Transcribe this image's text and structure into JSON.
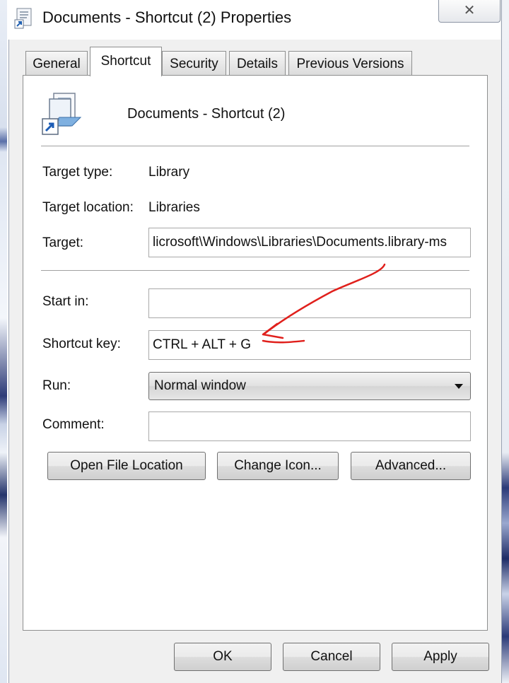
{
  "window": {
    "title": "Documents - Shortcut (2) Properties",
    "close_label": "✕"
  },
  "tabs": [
    {
      "label": "General",
      "active": false
    },
    {
      "label": "Shortcut",
      "active": true
    },
    {
      "label": "Security",
      "active": false
    },
    {
      "label": "Details",
      "active": false
    },
    {
      "label": "Previous Versions",
      "active": false
    }
  ],
  "shortcut": {
    "name": "Documents - Shortcut (2)",
    "icon": "library-shortcut-icon"
  },
  "fields": {
    "target_type": {
      "label": "Target type:",
      "value": "Library"
    },
    "target_location": {
      "label": "Target location:",
      "value": "Libraries"
    },
    "target": {
      "label": "Target:",
      "value": "licrosoft\\Windows\\Libraries\\Documents.library-ms"
    },
    "start_in": {
      "label": "Start in:",
      "value": ""
    },
    "shortcut_key": {
      "label": "Shortcut key:",
      "value": "CTRL + ALT + G"
    },
    "run": {
      "label": "Run:",
      "value": "Normal window"
    },
    "comment": {
      "label": "Comment:",
      "value": ""
    }
  },
  "panel_buttons": {
    "open_file_location": "Open File Location",
    "change_icon": "Change Icon...",
    "advanced": "Advanced..."
  },
  "footer_buttons": {
    "ok": "OK",
    "cancel": "Cancel",
    "apply": "Apply"
  },
  "colors": {
    "annotation": "#e0201c"
  }
}
